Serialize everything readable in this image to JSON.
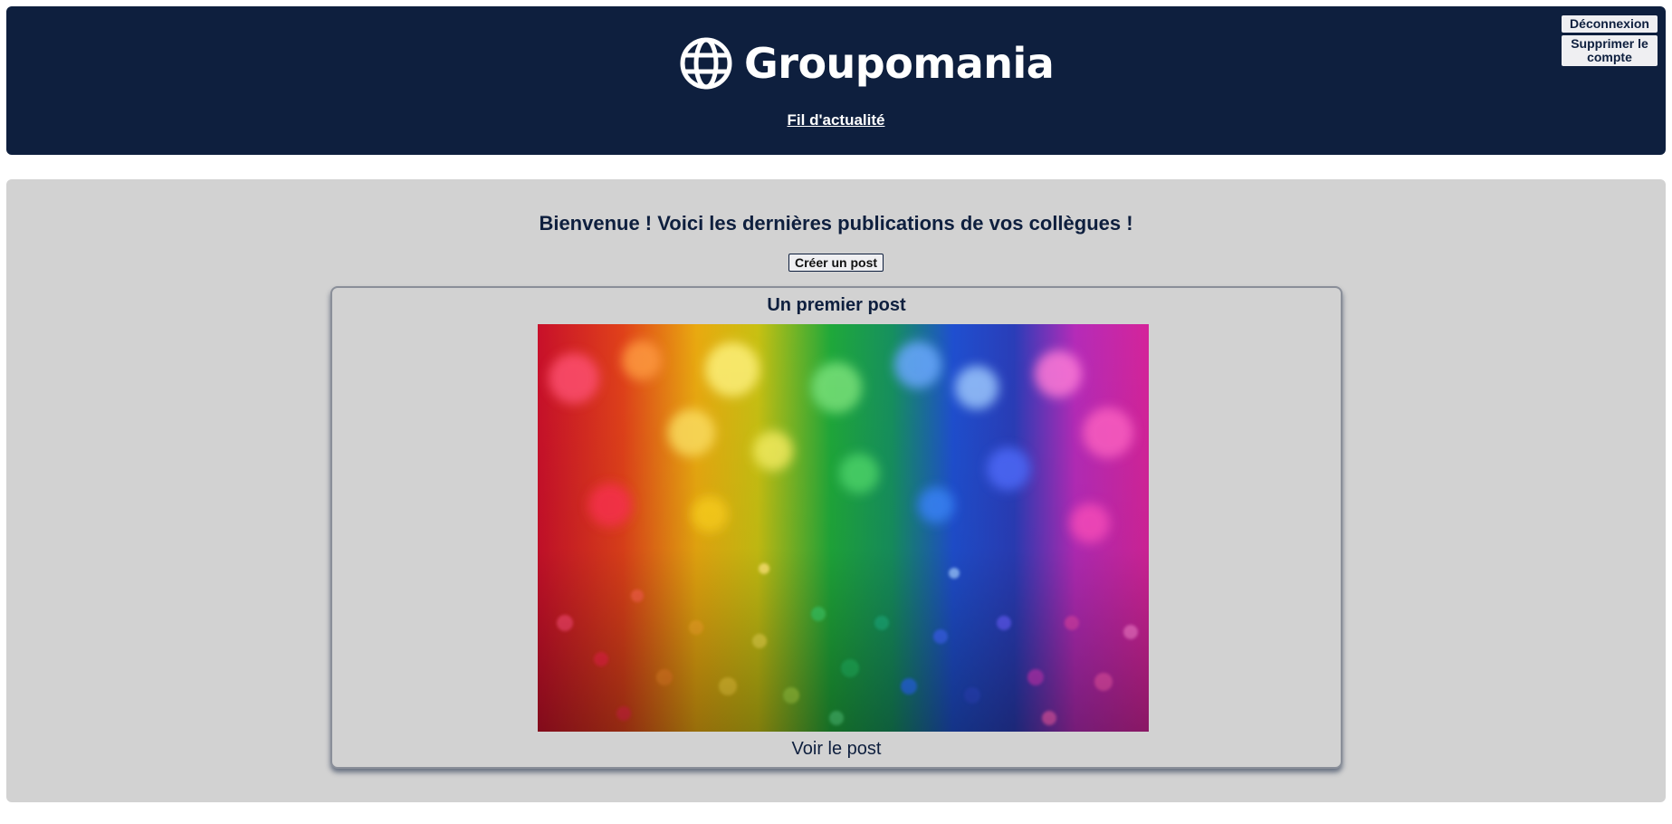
{
  "header": {
    "brand_name": "Groupomania",
    "logo_icon": "globe-icon",
    "nav_link": "Fil d'actualité",
    "colors": {
      "background": "#0e1f3e",
      "text": "#ffffff"
    }
  },
  "account": {
    "logout_label": "Déconnexion",
    "delete_label": "Supprimer le compte"
  },
  "main": {
    "welcome_text": "Bienvenue ! Voici les dernières publications de vos collègues !",
    "create_post_label": "Créer un post",
    "colors": {
      "background": "#d2d2d2",
      "text": "#0e1f3e"
    }
  },
  "posts": [
    {
      "title": "Un premier post",
      "image_alt": "rainbow-glitter-photo",
      "view_label": "Voir le post"
    }
  ]
}
